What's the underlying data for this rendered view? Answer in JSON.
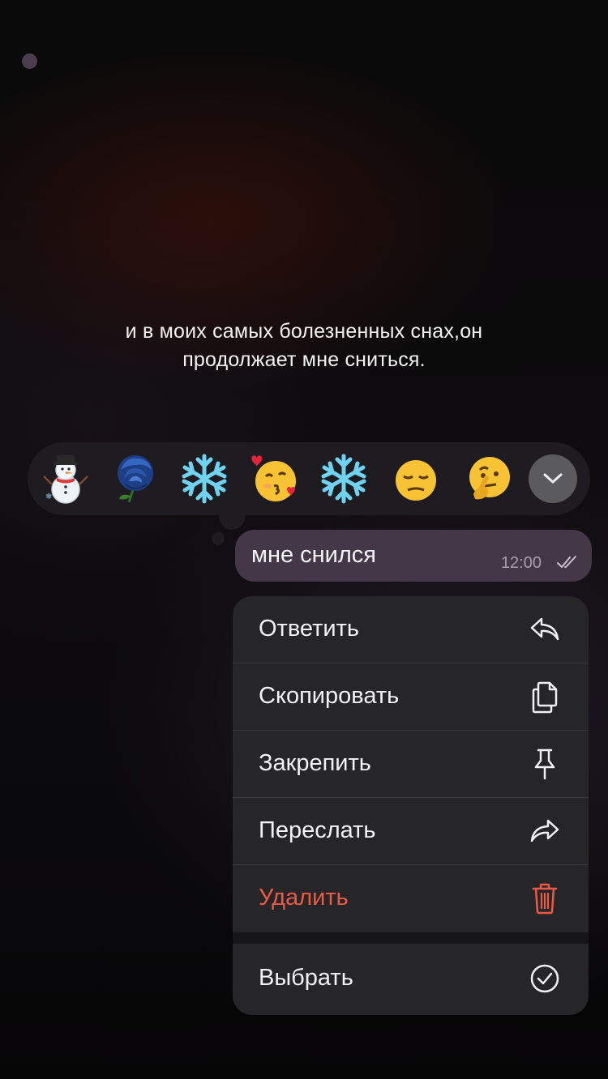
{
  "caption": {
    "line1": "и в моих самых болезненных снах,он",
    "line2": "продолжает мне сниться."
  },
  "reactions": [
    {
      "icon": "snowman-emoji",
      "glyph": "☃"
    },
    {
      "icon": "blue-rose-emoji",
      "glyph": "❀"
    },
    {
      "icon": "snowflake-emoji",
      "glyph": "❄"
    },
    {
      "icon": "kissing-face-with-hearts-emoji",
      "glyph": ""
    },
    {
      "icon": "snowflake-emoji",
      "glyph": "❄"
    },
    {
      "icon": "unamused-face-emoji",
      "glyph": ""
    },
    {
      "icon": "thinking-face-emoji",
      "glyph": ""
    }
  ],
  "expand_icon": "chevron-down-icon",
  "message": {
    "text": "мне снился",
    "time": "12:00",
    "status_icon": "double-check-icon"
  },
  "menu": {
    "items": [
      {
        "label": "Ответить",
        "icon": "reply-icon"
      },
      {
        "label": "Скопировать",
        "icon": "copy-icon"
      },
      {
        "label": "Закрепить",
        "icon": "pin-icon"
      },
      {
        "label": "Переслать",
        "icon": "forward-icon"
      },
      {
        "label": "Удалить",
        "icon": "trash-icon",
        "color": "#ec5a46"
      }
    ],
    "select": {
      "label": "Выбрать",
      "icon": "checkmark-circle-icon"
    }
  },
  "colors": {
    "reaction_bar": "#1f1c21",
    "message_bubble": "#433748",
    "menu_background": "#262527",
    "danger": "#ec5a46"
  }
}
